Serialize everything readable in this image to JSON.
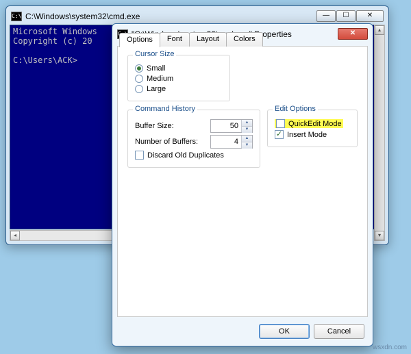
{
  "cmd": {
    "title": "C:\\Windows\\system32\\cmd.exe",
    "line1": "Microsoft Windows",
    "line2": "Copyright (c) 20",
    "prompt": "C:\\Users\\ACK>"
  },
  "props": {
    "title": "\"C:\\Windows\\system32\\cmd.exe\" Properties",
    "tabs": {
      "options": "Options",
      "font": "Font",
      "layout": "Layout",
      "colors": "Colors"
    },
    "cursor": {
      "title": "Cursor Size",
      "small": "Small",
      "medium": "Medium",
      "large": "Large"
    },
    "history": {
      "title": "Command History",
      "buffer_label": "Buffer Size:",
      "buffer_value": "50",
      "num_label": "Number of Buffers:",
      "num_value": "4",
      "discard": "Discard Old Duplicates"
    },
    "edit": {
      "title": "Edit Options",
      "quickedit": "QuickEdit Mode",
      "insert": "Insert Mode"
    },
    "ok": "OK",
    "cancel": "Cancel"
  },
  "glyphs": {
    "icon": "C:\\",
    "min": "—",
    "max": "☐",
    "close": "✕",
    "left": "◂",
    "right": "▸",
    "up": "▴",
    "down": "▾",
    "spin_up": "▲",
    "spin_down": "▼",
    "check": "✓"
  },
  "watermark": "wsxdn.com"
}
